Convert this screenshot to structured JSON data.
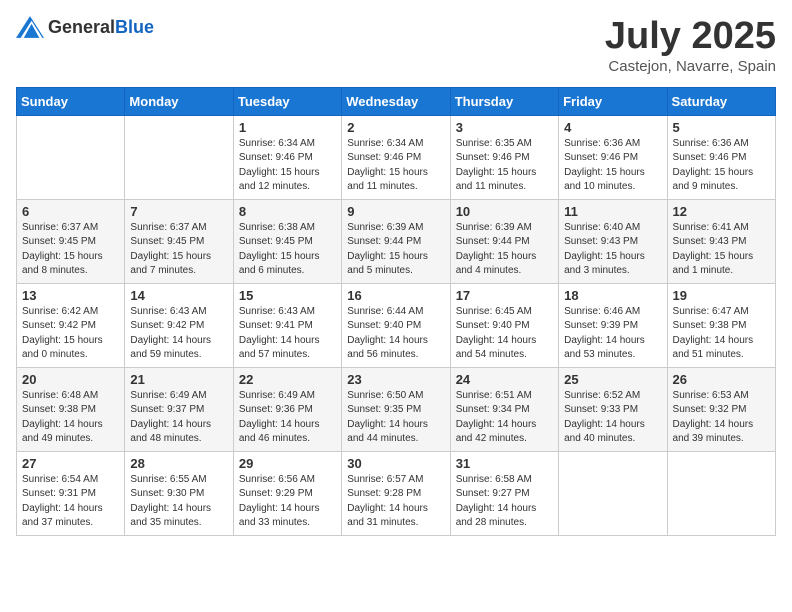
{
  "header": {
    "logo_general": "General",
    "logo_blue": "Blue",
    "month": "July 2025",
    "location": "Castejon, Navarre, Spain"
  },
  "weekdays": [
    "Sunday",
    "Monday",
    "Tuesday",
    "Wednesday",
    "Thursday",
    "Friday",
    "Saturday"
  ],
  "weeks": [
    [
      {
        "day": "",
        "sunrise": "",
        "sunset": "",
        "daylight": ""
      },
      {
        "day": "",
        "sunrise": "",
        "sunset": "",
        "daylight": ""
      },
      {
        "day": "1",
        "sunrise": "Sunrise: 6:34 AM",
        "sunset": "Sunset: 9:46 PM",
        "daylight": "Daylight: 15 hours and 12 minutes."
      },
      {
        "day": "2",
        "sunrise": "Sunrise: 6:34 AM",
        "sunset": "Sunset: 9:46 PM",
        "daylight": "Daylight: 15 hours and 11 minutes."
      },
      {
        "day": "3",
        "sunrise": "Sunrise: 6:35 AM",
        "sunset": "Sunset: 9:46 PM",
        "daylight": "Daylight: 15 hours and 11 minutes."
      },
      {
        "day": "4",
        "sunrise": "Sunrise: 6:36 AM",
        "sunset": "Sunset: 9:46 PM",
        "daylight": "Daylight: 15 hours and 10 minutes."
      },
      {
        "day": "5",
        "sunrise": "Sunrise: 6:36 AM",
        "sunset": "Sunset: 9:46 PM",
        "daylight": "Daylight: 15 hours and 9 minutes."
      }
    ],
    [
      {
        "day": "6",
        "sunrise": "Sunrise: 6:37 AM",
        "sunset": "Sunset: 9:45 PM",
        "daylight": "Daylight: 15 hours and 8 minutes."
      },
      {
        "day": "7",
        "sunrise": "Sunrise: 6:37 AM",
        "sunset": "Sunset: 9:45 PM",
        "daylight": "Daylight: 15 hours and 7 minutes."
      },
      {
        "day": "8",
        "sunrise": "Sunrise: 6:38 AM",
        "sunset": "Sunset: 9:45 PM",
        "daylight": "Daylight: 15 hours and 6 minutes."
      },
      {
        "day": "9",
        "sunrise": "Sunrise: 6:39 AM",
        "sunset": "Sunset: 9:44 PM",
        "daylight": "Daylight: 15 hours and 5 minutes."
      },
      {
        "day": "10",
        "sunrise": "Sunrise: 6:39 AM",
        "sunset": "Sunset: 9:44 PM",
        "daylight": "Daylight: 15 hours and 4 minutes."
      },
      {
        "day": "11",
        "sunrise": "Sunrise: 6:40 AM",
        "sunset": "Sunset: 9:43 PM",
        "daylight": "Daylight: 15 hours and 3 minutes."
      },
      {
        "day": "12",
        "sunrise": "Sunrise: 6:41 AM",
        "sunset": "Sunset: 9:43 PM",
        "daylight": "Daylight: 15 hours and 1 minute."
      }
    ],
    [
      {
        "day": "13",
        "sunrise": "Sunrise: 6:42 AM",
        "sunset": "Sunset: 9:42 PM",
        "daylight": "Daylight: 15 hours and 0 minutes."
      },
      {
        "day": "14",
        "sunrise": "Sunrise: 6:43 AM",
        "sunset": "Sunset: 9:42 PM",
        "daylight": "Daylight: 14 hours and 59 minutes."
      },
      {
        "day": "15",
        "sunrise": "Sunrise: 6:43 AM",
        "sunset": "Sunset: 9:41 PM",
        "daylight": "Daylight: 14 hours and 57 minutes."
      },
      {
        "day": "16",
        "sunrise": "Sunrise: 6:44 AM",
        "sunset": "Sunset: 9:40 PM",
        "daylight": "Daylight: 14 hours and 56 minutes."
      },
      {
        "day": "17",
        "sunrise": "Sunrise: 6:45 AM",
        "sunset": "Sunset: 9:40 PM",
        "daylight": "Daylight: 14 hours and 54 minutes."
      },
      {
        "day": "18",
        "sunrise": "Sunrise: 6:46 AM",
        "sunset": "Sunset: 9:39 PM",
        "daylight": "Daylight: 14 hours and 53 minutes."
      },
      {
        "day": "19",
        "sunrise": "Sunrise: 6:47 AM",
        "sunset": "Sunset: 9:38 PM",
        "daylight": "Daylight: 14 hours and 51 minutes."
      }
    ],
    [
      {
        "day": "20",
        "sunrise": "Sunrise: 6:48 AM",
        "sunset": "Sunset: 9:38 PM",
        "daylight": "Daylight: 14 hours and 49 minutes."
      },
      {
        "day": "21",
        "sunrise": "Sunrise: 6:49 AM",
        "sunset": "Sunset: 9:37 PM",
        "daylight": "Daylight: 14 hours and 48 minutes."
      },
      {
        "day": "22",
        "sunrise": "Sunrise: 6:49 AM",
        "sunset": "Sunset: 9:36 PM",
        "daylight": "Daylight: 14 hours and 46 minutes."
      },
      {
        "day": "23",
        "sunrise": "Sunrise: 6:50 AM",
        "sunset": "Sunset: 9:35 PM",
        "daylight": "Daylight: 14 hours and 44 minutes."
      },
      {
        "day": "24",
        "sunrise": "Sunrise: 6:51 AM",
        "sunset": "Sunset: 9:34 PM",
        "daylight": "Daylight: 14 hours and 42 minutes."
      },
      {
        "day": "25",
        "sunrise": "Sunrise: 6:52 AM",
        "sunset": "Sunset: 9:33 PM",
        "daylight": "Daylight: 14 hours and 40 minutes."
      },
      {
        "day": "26",
        "sunrise": "Sunrise: 6:53 AM",
        "sunset": "Sunset: 9:32 PM",
        "daylight": "Daylight: 14 hours and 39 minutes."
      }
    ],
    [
      {
        "day": "27",
        "sunrise": "Sunrise: 6:54 AM",
        "sunset": "Sunset: 9:31 PM",
        "daylight": "Daylight: 14 hours and 37 minutes."
      },
      {
        "day": "28",
        "sunrise": "Sunrise: 6:55 AM",
        "sunset": "Sunset: 9:30 PM",
        "daylight": "Daylight: 14 hours and 35 minutes."
      },
      {
        "day": "29",
        "sunrise": "Sunrise: 6:56 AM",
        "sunset": "Sunset: 9:29 PM",
        "daylight": "Daylight: 14 hours and 33 minutes."
      },
      {
        "day": "30",
        "sunrise": "Sunrise: 6:57 AM",
        "sunset": "Sunset: 9:28 PM",
        "daylight": "Daylight: 14 hours and 31 minutes."
      },
      {
        "day": "31",
        "sunrise": "Sunrise: 6:58 AM",
        "sunset": "Sunset: 9:27 PM",
        "daylight": "Daylight: 14 hours and 28 minutes."
      },
      {
        "day": "",
        "sunrise": "",
        "sunset": "",
        "daylight": ""
      },
      {
        "day": "",
        "sunrise": "",
        "sunset": "",
        "daylight": ""
      }
    ]
  ]
}
